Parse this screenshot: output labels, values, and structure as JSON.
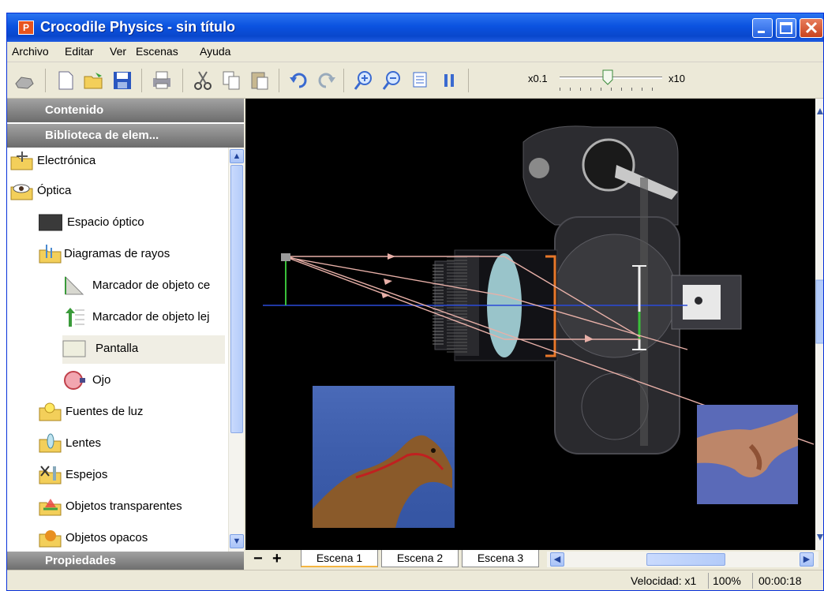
{
  "window": {
    "title": "Crocodile Physics - sin título",
    "app_icon_letter": "P"
  },
  "menu": [
    "Archivo",
    "Editar",
    "Ver",
    "Escenas",
    "Ayuda"
  ],
  "toolbar": {
    "speed_min_label": "x0.1",
    "speed_max_label": "x10",
    "icons": [
      "hand-icon",
      "new-icon",
      "open-icon",
      "save-icon",
      "print-icon",
      "cut-icon",
      "copy-icon",
      "paste-icon",
      "undo-icon",
      "redo-icon",
      "zoom-in-icon",
      "zoom-out-icon",
      "fit-icon",
      "pause-icon"
    ]
  },
  "panels": {
    "contenido": "Contenido",
    "biblioteca": "Biblioteca de elem...",
    "propiedades": "Propiedades"
  },
  "tree": [
    {
      "label": "Electrónica",
      "icon": "folder-electronics-icon"
    },
    {
      "label": "Óptica",
      "icon": "eye-folder-icon"
    },
    {
      "label": "Espacio óptico",
      "icon": "optical-space-icon"
    },
    {
      "label": "Diagramas de rayos",
      "icon": "ray-diagram-folder-icon"
    },
    {
      "label": "Marcador de objeto ce",
      "icon": "near-object-marker-icon"
    },
    {
      "label": "Marcador de objeto lej",
      "icon": "far-object-marker-icon"
    },
    {
      "label": "Pantalla",
      "icon": "screen-icon"
    },
    {
      "label": "Ojo",
      "icon": "eye-icon"
    },
    {
      "label": "Fuentes de luz",
      "icon": "light-source-folder-icon"
    },
    {
      "label": "Lentes",
      "icon": "lens-folder-icon"
    },
    {
      "label": "Espejos",
      "icon": "mirror-folder-icon"
    },
    {
      "label": "Objetos transparentes",
      "icon": "transparent-folder-icon"
    },
    {
      "label": "Objetos opacos",
      "icon": "opaque-folder-icon"
    }
  ],
  "scenes": {
    "tabs": [
      "Escena 1",
      "Escena 2",
      "Escena 3"
    ],
    "active": 0,
    "minus": "−",
    "plus": "+"
  },
  "status": {
    "speed": "Velocidad: x1",
    "zoom": "100%",
    "time": "00:00:18"
  },
  "colors": {
    "titlebar": "#0b52e0",
    "panel_header": "#7a7a7a",
    "canvas": "#000000",
    "ray": "#e8b0a8",
    "axis": "#2a4ad8"
  }
}
